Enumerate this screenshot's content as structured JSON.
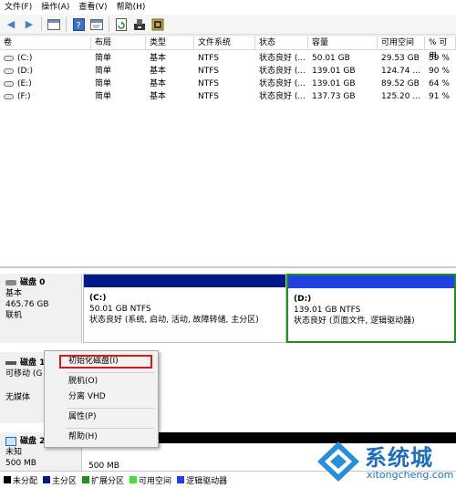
{
  "menu": [
    "文件(F)",
    "操作(A)",
    "查看(V)",
    "帮助(H)"
  ],
  "table": {
    "headers": [
      "卷",
      "布局",
      "类型",
      "文件系统",
      "状态",
      "容量",
      "可用空间",
      "% 可用"
    ],
    "rows": [
      [
        "(C:)",
        "简单",
        "基本",
        "NTFS",
        "状态良好 (...",
        "50.01 GB",
        "29.53 GB",
        "59 %"
      ],
      [
        "(D:)",
        "简单",
        "基本",
        "NTFS",
        "状态良好 (...",
        "139.01 GB",
        "124.74 ...",
        "90 %"
      ],
      [
        "(E:)",
        "简单",
        "基本",
        "NTFS",
        "状态良好 (...",
        "139.01 GB",
        "89.52 GB",
        "64 %"
      ],
      [
        "(F:)",
        "简单",
        "基本",
        "NTFS",
        "状态良好 (...",
        "137.73 GB",
        "125.20 ...",
        "91 %"
      ]
    ]
  },
  "disk0": {
    "title": "磁盘 0",
    "type": "基本",
    "size": "465.76 GB",
    "status": "联机",
    "partitions": [
      {
        "name": "(C:)",
        "size": "50.01 GB NTFS",
        "status": "状态良好 (系统, 启动, 活动, 故障转储, 主分区)"
      },
      {
        "name": "(D:)",
        "size": "139.01 GB NTFS",
        "status": "状态良好 (页面文件, 逻辑驱动器)"
      }
    ]
  },
  "disk1": {
    "title": "磁盘 1",
    "type": "可移动 (G",
    "status": "无媒体"
  },
  "disk2": {
    "title": "磁盘 2",
    "type": "未知",
    "size": "500 MB",
    "part_size": "500 MB"
  },
  "context_menu": {
    "items": [
      "初始化磁盘(I)",
      "脱机(O)",
      "分离 VHD",
      "属性(P)",
      "帮助(H)"
    ]
  },
  "legend": [
    {
      "label": "未分配",
      "color": "#000000"
    },
    {
      "label": "主分区",
      "color": "#001a8c"
    },
    {
      "label": "扩展分区",
      "color": "#1f8f1f"
    },
    {
      "label": "可用空间",
      "color": "#40e040"
    },
    {
      "label": "逻辑驱动器",
      "color": "#2040e0"
    }
  ],
  "watermark": {
    "brand": "系统城",
    "url": "xitongcheng.com"
  },
  "colors": {
    "primary_partition": "#001a8c",
    "selected_border": "#1f8f1f",
    "highlight": "#d8171f"
  }
}
